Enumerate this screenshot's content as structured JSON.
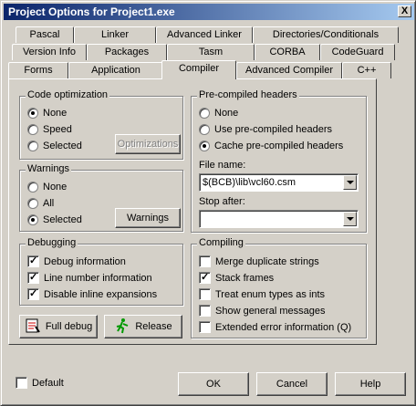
{
  "window": {
    "title": "Project Options for Project1.exe",
    "close_glyph": "X"
  },
  "tabs": {
    "row1": [
      "Pascal",
      "Linker",
      "Advanced Linker",
      "Directories/Conditionals"
    ],
    "row2": [
      "Version Info",
      "Packages",
      "Tasm",
      "CORBA",
      "CodeGuard"
    ],
    "row3": [
      "Forms",
      "Application",
      "Compiler",
      "Advanced Compiler",
      "C++"
    ],
    "active": "Compiler"
  },
  "code_optimization": {
    "title": "Code optimization",
    "options": [
      "None",
      "Speed",
      "Selected"
    ],
    "selected": "None",
    "optimizations_button": "Optimizations"
  },
  "warnings": {
    "title": "Warnings",
    "options": [
      "None",
      "All",
      "Selected"
    ],
    "selected": "Selected",
    "warnings_button": "Warnings"
  },
  "debugging": {
    "title": "Debugging",
    "items": [
      {
        "label": "Debug information",
        "checked": true
      },
      {
        "label": "Line number information",
        "checked": true
      },
      {
        "label": "Disable inline expansions",
        "checked": true
      }
    ]
  },
  "buttons": {
    "full_debug": "Full debug",
    "release": "Release"
  },
  "precompiled_headers": {
    "title": "Pre-compiled headers",
    "options": [
      "None",
      "Use pre-compiled headers",
      "Cache pre-compiled headers"
    ],
    "selected": "Cache pre-compiled headers",
    "file_name_label": "File name:",
    "file_name_value": "$(BCB)\\lib\\vcl60.csm",
    "stop_after_label": "Stop after:",
    "stop_after_value": ""
  },
  "compiling": {
    "title": "Compiling",
    "items": [
      {
        "label": "Merge duplicate strings",
        "checked": false
      },
      {
        "label": "Stack frames",
        "checked": true
      },
      {
        "label": "Treat enum types as ints",
        "checked": false
      },
      {
        "label": "Show general messages",
        "checked": false
      },
      {
        "label": "Extended error information (Q)",
        "checked": false
      }
    ]
  },
  "footer": {
    "default_label": "Default",
    "default_checked": false,
    "ok": "OK",
    "cancel": "Cancel",
    "help": "Help"
  }
}
